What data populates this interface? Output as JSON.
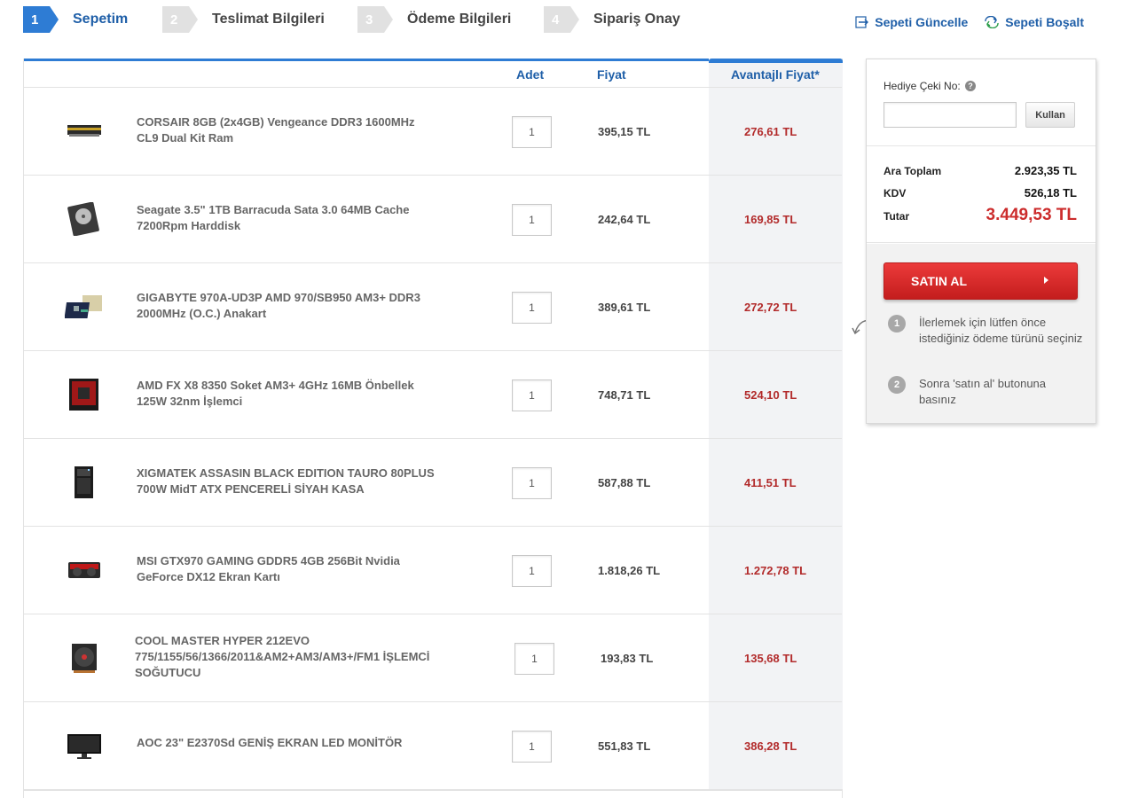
{
  "steps": [
    {
      "num": "1",
      "label": "Sepetim",
      "active": true
    },
    {
      "num": "2",
      "label": "Teslimat Bilgileri",
      "active": false
    },
    {
      "num": "3",
      "label": "Ödeme Bilgileri",
      "active": false
    },
    {
      "num": "4",
      "label": "Sipariş Onay",
      "active": false
    }
  ],
  "cart_actions": {
    "update": "Sepeti Güncelle",
    "empty": "Sepeti Boşalt"
  },
  "table": {
    "headers": {
      "qty": "Adet",
      "price": "Fiyat",
      "adv_price": "Avantajlı Fiyat*"
    },
    "rows": [
      {
        "image": "ram-image",
        "name": "CORSAIR 8GB (2x4GB) Vengeance DDR3 1600MHz CL9 Dual Kit Ram",
        "qty": "1",
        "price": "395,15 TL",
        "adv_price": "276,61 TL"
      },
      {
        "image": "harddisk-image",
        "name": "Seagate 3.5\" 1TB Barracuda Sata 3.0 64MB Cache 7200Rpm Harddisk",
        "qty": "1",
        "price": "242,64 TL",
        "adv_price": "169,85 TL"
      },
      {
        "image": "motherboard-image",
        "name": "GIGABYTE 970A-UD3P AMD 970/SB950 AM3+ DDR3 2000MHz (O.C.) Anakart",
        "qty": "1",
        "price": "389,61 TL",
        "adv_price": "272,72 TL"
      },
      {
        "image": "cpu-box-image",
        "name": "AMD FX X8 8350 Soket AM3+ 4GHz 16MB Önbellek 125W 32nm İşlemci",
        "qty": "1",
        "price": "748,71 TL",
        "adv_price": "524,10 TL"
      },
      {
        "image": "pc-case-image",
        "name": "XIGMATEK ASSASIN BLACK EDITION TAURO 80PLUS 700W MidT ATX PENCERELİ SİYAH KASA",
        "qty": "1",
        "price": "587,88 TL",
        "adv_price": "411,51 TL"
      },
      {
        "image": "graphics-card-image",
        "name": "MSI GTX970 GAMING GDDR5 4GB 256Bit Nvidia GeForce DX12 Ekran Kartı",
        "qty": "1",
        "price": "1.818,26 TL",
        "adv_price": "1.272,78 TL"
      },
      {
        "image": "cpu-cooler-image",
        "name": "COOL MASTER HYPER 212EVO 775/1155/56/1366/2011&AM2+AM3/AM3+/FM1 İŞLEMCİ SOĞUTUCU",
        "qty": "1",
        "price": "193,83 TL",
        "adv_price": "135,68 TL"
      },
      {
        "image": "monitor-image",
        "name": "AOC 23\" E2370Sd GENİŞ EKRAN LED MONİTÖR",
        "qty": "1",
        "price": "551,83 TL",
        "adv_price": "386,28 TL"
      }
    ]
  },
  "panel": {
    "gift_label": "Hediye Çeki No:",
    "gift_help": "?",
    "gift_input_value": "",
    "gift_button": "Kullan",
    "totals": {
      "subtotal_label": "Ara Toplam",
      "subtotal_value": "2.923,35 TL",
      "vat_label": "KDV",
      "vat_value": "526,18 TL",
      "total_label": "Tutar",
      "total_value": "3.449,53 TL"
    },
    "buy_button": "SATIN AL",
    "hints": [
      {
        "num": "1",
        "text": "İlerlemek için lütfen önce istediğiniz ödeme türünü seçiniz"
      },
      {
        "num": "2",
        "text": "Sonra 'satın al' butonuna basınız"
      }
    ]
  },
  "colors": {
    "accent_blue": "#2e7cd4",
    "link_blue": "#1f5fa8",
    "price_red": "#b22a2a",
    "buy_red": "#d42727"
  }
}
